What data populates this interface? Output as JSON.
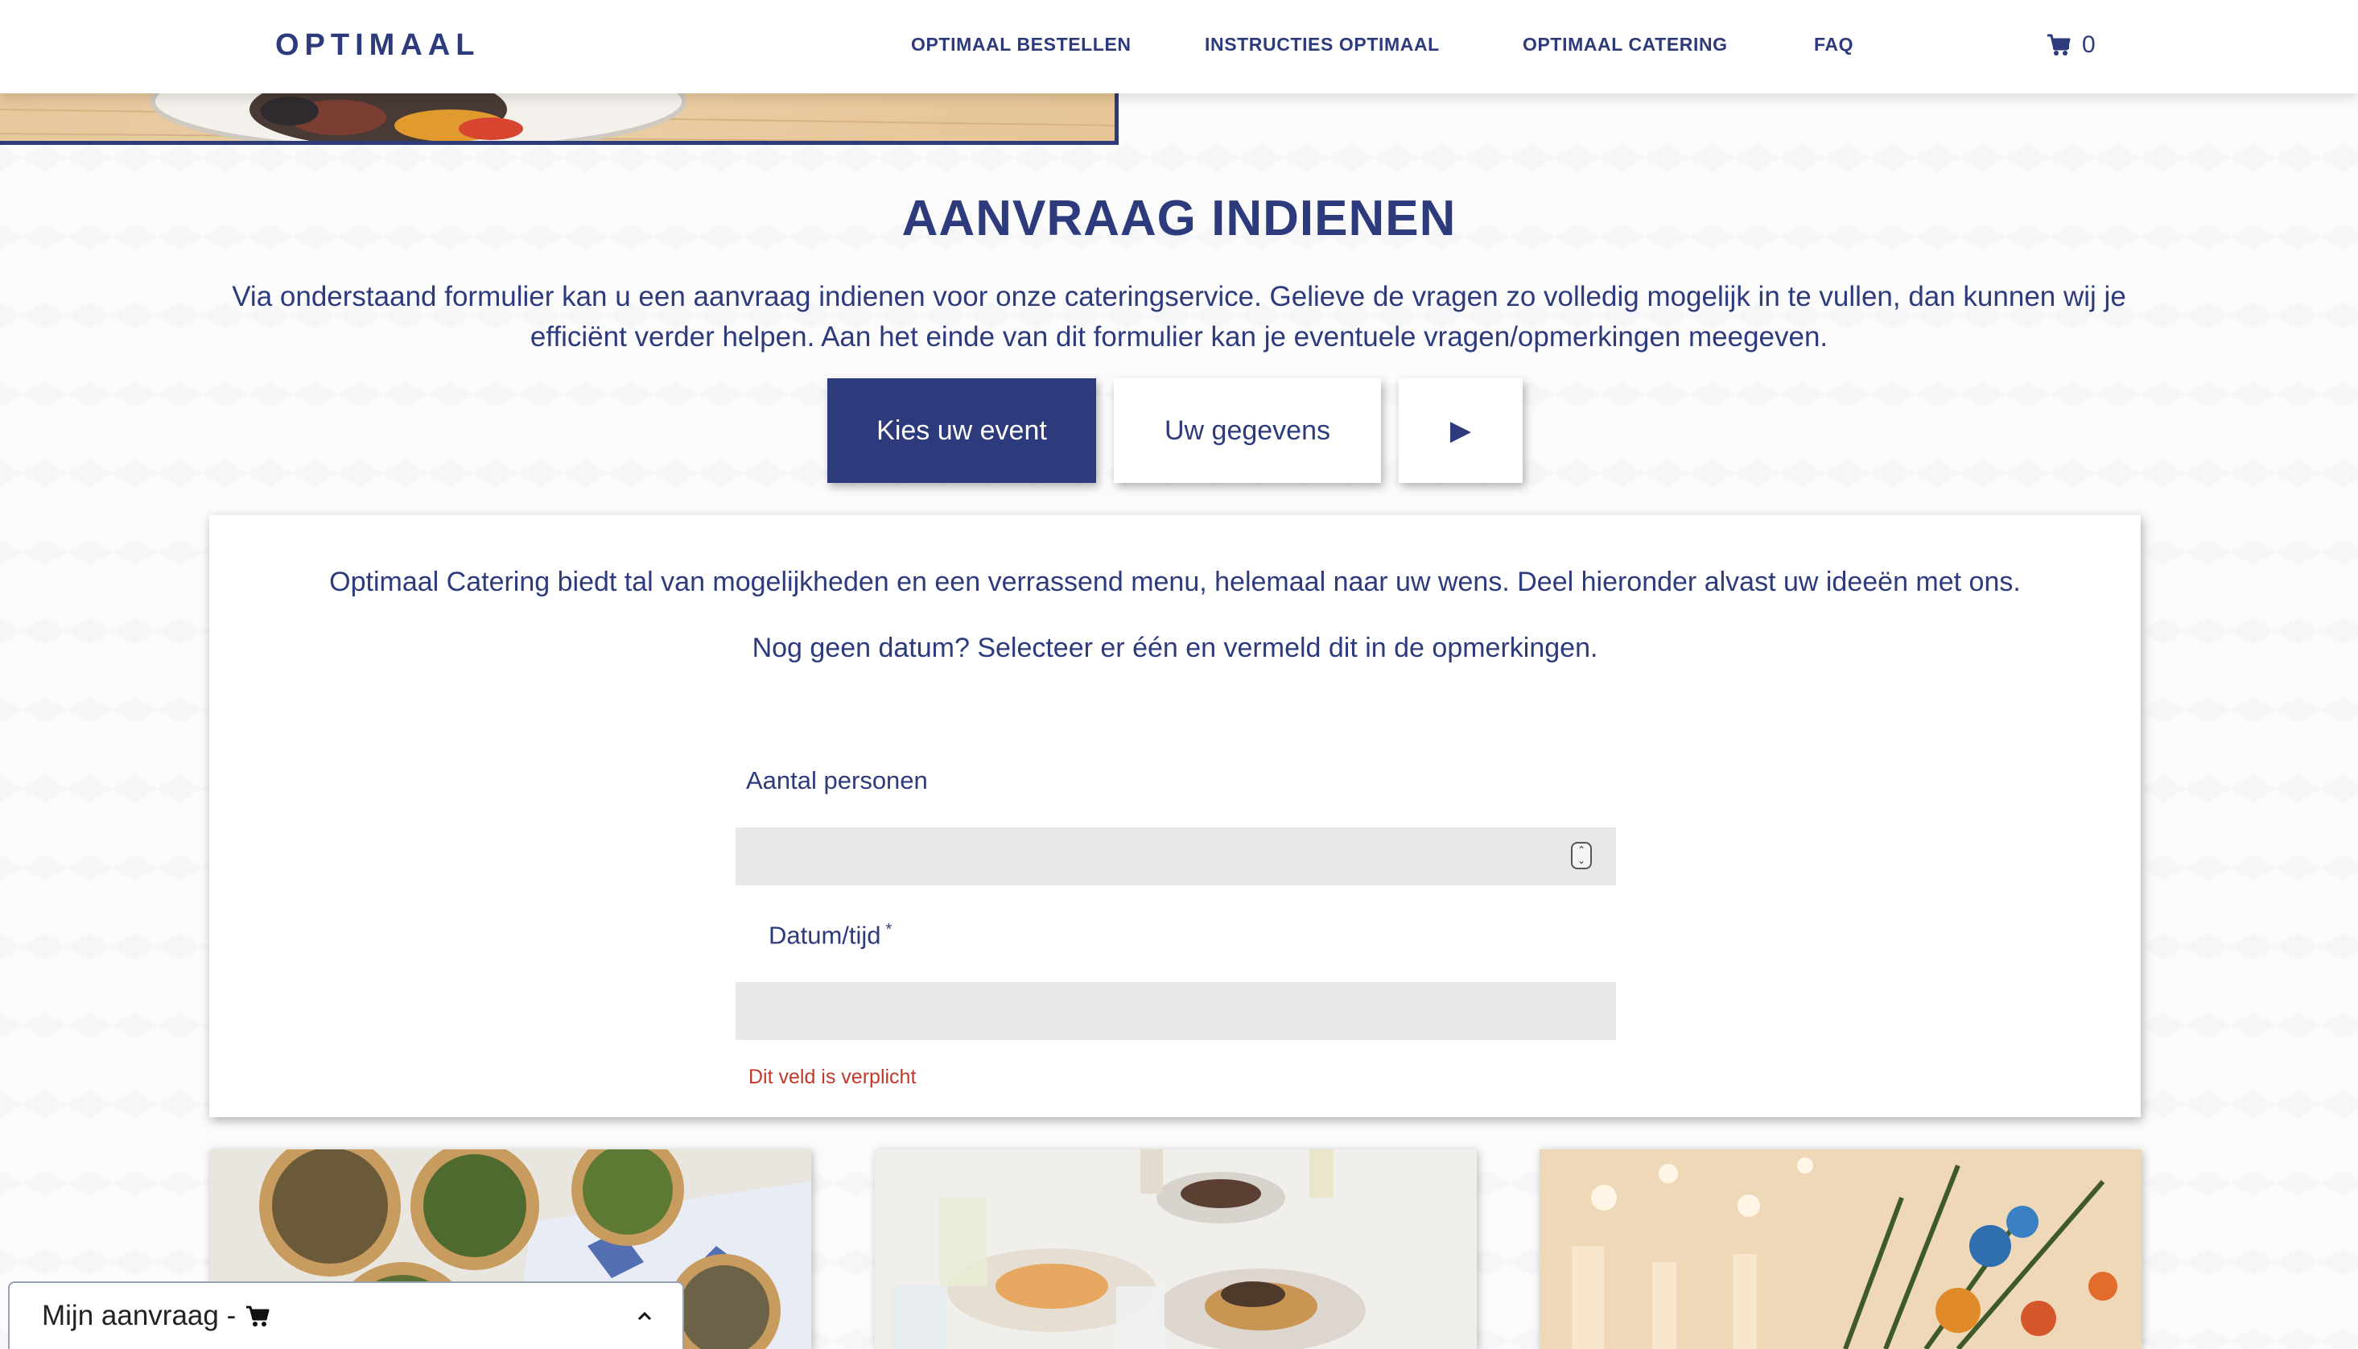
{
  "header": {
    "logo": "OPTIMAAL",
    "nav": [
      {
        "label": "OPTIMAAL BESTELLEN"
      },
      {
        "label": "INSTRUCTIES OPTIMAAL"
      },
      {
        "label": "OPTIMAAL CATERING"
      },
      {
        "label": "FAQ"
      }
    ],
    "cart_count": "0",
    "cart_icon": "shopping-cart-icon"
  },
  "page": {
    "title": "AANVRAAG INDIENEN",
    "intro": "Via onderstaand formulier kan u een aanvraag indienen voor onze cateringservice. Gelieve de vragen zo volledig mogelijk in te vullen, dan kunnen wij je efficiënt verder helpen. Aan het einde van dit formulier kan je eventuele vragen/opmerkingen meegeven."
  },
  "steps": {
    "tabs": [
      {
        "label": "Kies uw event",
        "active": true
      },
      {
        "label": "Uw gegevens",
        "active": false
      },
      {
        "label": "▶",
        "active": false
      }
    ]
  },
  "form": {
    "text1": "Optimaal Catering biedt tal van mogelijkheden en een verrassend menu, helemaal naar uw wens. Deel hieronder alvast uw ideeën met ons.",
    "text2": "Nog geen datum? Selecteer er één en vermeld dit in de opmerkingen.",
    "persons_label": "Aantal personen",
    "persons_value": "",
    "date_label": "Datum/tijd",
    "date_required_mark": "*",
    "date_value": "",
    "error": "Dit veld is verplicht"
  },
  "request_bar": {
    "label": "Mijn aanvraag -",
    "icon": "shopping-cart-icon",
    "toggle_icon": "chevron-up-icon"
  },
  "colors": {
    "brand": "#2d3a7c",
    "error": "#c0392b",
    "field_bg": "#e8e8e8"
  }
}
